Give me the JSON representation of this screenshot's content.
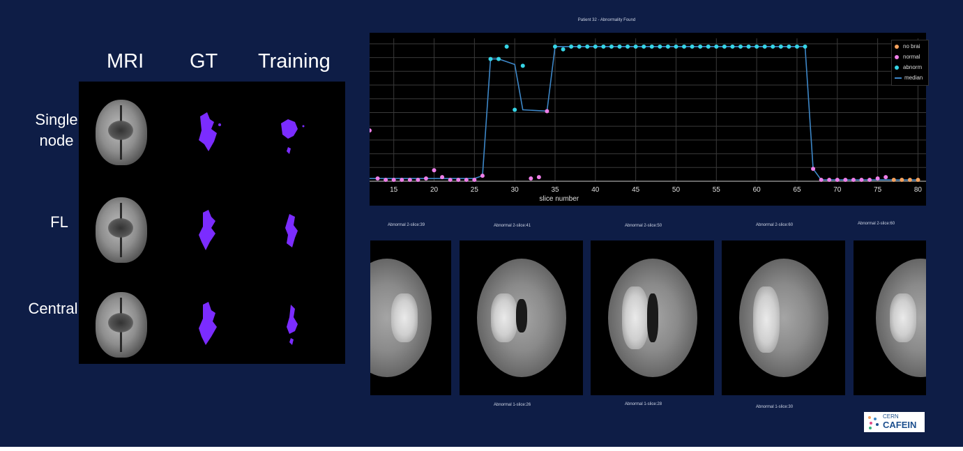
{
  "grid": {
    "columns": [
      "MRI",
      "GT",
      "Training"
    ],
    "rows": [
      "Single node",
      "FL",
      "Central"
    ]
  },
  "lesion_color": "#7b2cff",
  "logo": {
    "top": "CERN",
    "bottom": "CAFEIN"
  },
  "slices": [
    {
      "top_label": "Abnormal 2-slice:39",
      "bottom_label": ""
    },
    {
      "top_label": "Abnormal 2-slice:41",
      "bottom_label": "Abnormal 1-slice:26"
    },
    {
      "top_label": "Abnormal 2-slice:50",
      "bottom_label": "Abnormal 1-slice:28"
    },
    {
      "top_label": "Abnormal 2-slice:60",
      "bottom_label": "Abnormal 1-slice:30"
    },
    {
      "top_label": "Abnormal 2-slice:60",
      "bottom_label": ""
    }
  ],
  "chart_data": {
    "type": "scatter",
    "title": "Patient 32 - Abnormality Found",
    "xlabel": "slice number",
    "ylabel": "",
    "xlim": [
      12,
      81
    ],
    "ylim": [
      0,
      1.04
    ],
    "xticks": [
      15,
      20,
      25,
      30,
      35,
      40,
      45,
      50,
      55,
      60,
      65,
      70,
      75,
      80
    ],
    "grid": true,
    "legend_position": "top-right",
    "legend": [
      "no brai",
      "normal",
      "abnorm",
      "median"
    ],
    "colors": {
      "no_brain": "#f5a25d",
      "normal": "#ee7fe8",
      "abnormal": "#36d5e6",
      "median": "#3d87c8"
    },
    "series": [
      {
        "name": "no brai",
        "points": [
          [
            77,
            0.01
          ],
          [
            78,
            0.01
          ],
          [
            79,
            0.01
          ],
          [
            80,
            0.01
          ]
        ]
      },
      {
        "name": "normal",
        "points": [
          [
            12,
            0.37
          ],
          [
            13,
            0.02
          ],
          [
            14,
            0.01
          ],
          [
            15,
            0.01
          ],
          [
            16,
            0.01
          ],
          [
            17,
            0.01
          ],
          [
            18,
            0.01
          ],
          [
            19,
            0.02
          ],
          [
            20,
            0.08
          ],
          [
            21,
            0.03
          ],
          [
            22,
            0.01
          ],
          [
            23,
            0.01
          ],
          [
            24,
            0.01
          ],
          [
            25,
            0.01
          ],
          [
            26,
            0.04
          ],
          [
            32,
            0.02
          ],
          [
            33,
            0.03
          ],
          [
            34,
            0.51
          ],
          [
            67,
            0.09
          ],
          [
            68,
            0.01
          ],
          [
            69,
            0.01
          ],
          [
            70,
            0.01
          ],
          [
            71,
            0.01
          ],
          [
            72,
            0.01
          ],
          [
            73,
            0.01
          ],
          [
            74,
            0.01
          ],
          [
            75,
            0.02
          ],
          [
            76,
            0.03
          ]
        ]
      },
      {
        "name": "abnorm",
        "points": [
          [
            27,
            0.89
          ],
          [
            28,
            0.89
          ],
          [
            29,
            0.98
          ],
          [
            30,
            0.52
          ],
          [
            31,
            0.84
          ],
          [
            35,
            0.98
          ],
          [
            36,
            0.96
          ],
          [
            37,
            0.98
          ],
          [
            38,
            0.98
          ],
          [
            39,
            0.98
          ],
          [
            40,
            0.98
          ],
          [
            41,
            0.98
          ],
          [
            42,
            0.98
          ],
          [
            43,
            0.98
          ],
          [
            44,
            0.98
          ],
          [
            45,
            0.98
          ],
          [
            46,
            0.98
          ],
          [
            47,
            0.98
          ],
          [
            48,
            0.98
          ],
          [
            49,
            0.98
          ],
          [
            50,
            0.98
          ],
          [
            51,
            0.98
          ],
          [
            52,
            0.98
          ],
          [
            53,
            0.98
          ],
          [
            54,
            0.98
          ],
          [
            55,
            0.98
          ],
          [
            56,
            0.98
          ],
          [
            57,
            0.98
          ],
          [
            58,
            0.98
          ],
          [
            59,
            0.98
          ],
          [
            60,
            0.98
          ],
          [
            61,
            0.98
          ],
          [
            62,
            0.98
          ],
          [
            63,
            0.98
          ],
          [
            64,
            0.98
          ],
          [
            65,
            0.98
          ],
          [
            66,
            0.98
          ]
        ]
      },
      {
        "name": "median",
        "line": [
          [
            12,
            0.02
          ],
          [
            25,
            0.02
          ],
          [
            26,
            0.04
          ],
          [
            27,
            0.89
          ],
          [
            28,
            0.89
          ],
          [
            29,
            0.87
          ],
          [
            30,
            0.85
          ],
          [
            31,
            0.52
          ],
          [
            34,
            0.51
          ],
          [
            35,
            0.98
          ],
          [
            66,
            0.98
          ],
          [
            67,
            0.09
          ],
          [
            68,
            0.01
          ],
          [
            80,
            0.01
          ]
        ]
      }
    ]
  }
}
